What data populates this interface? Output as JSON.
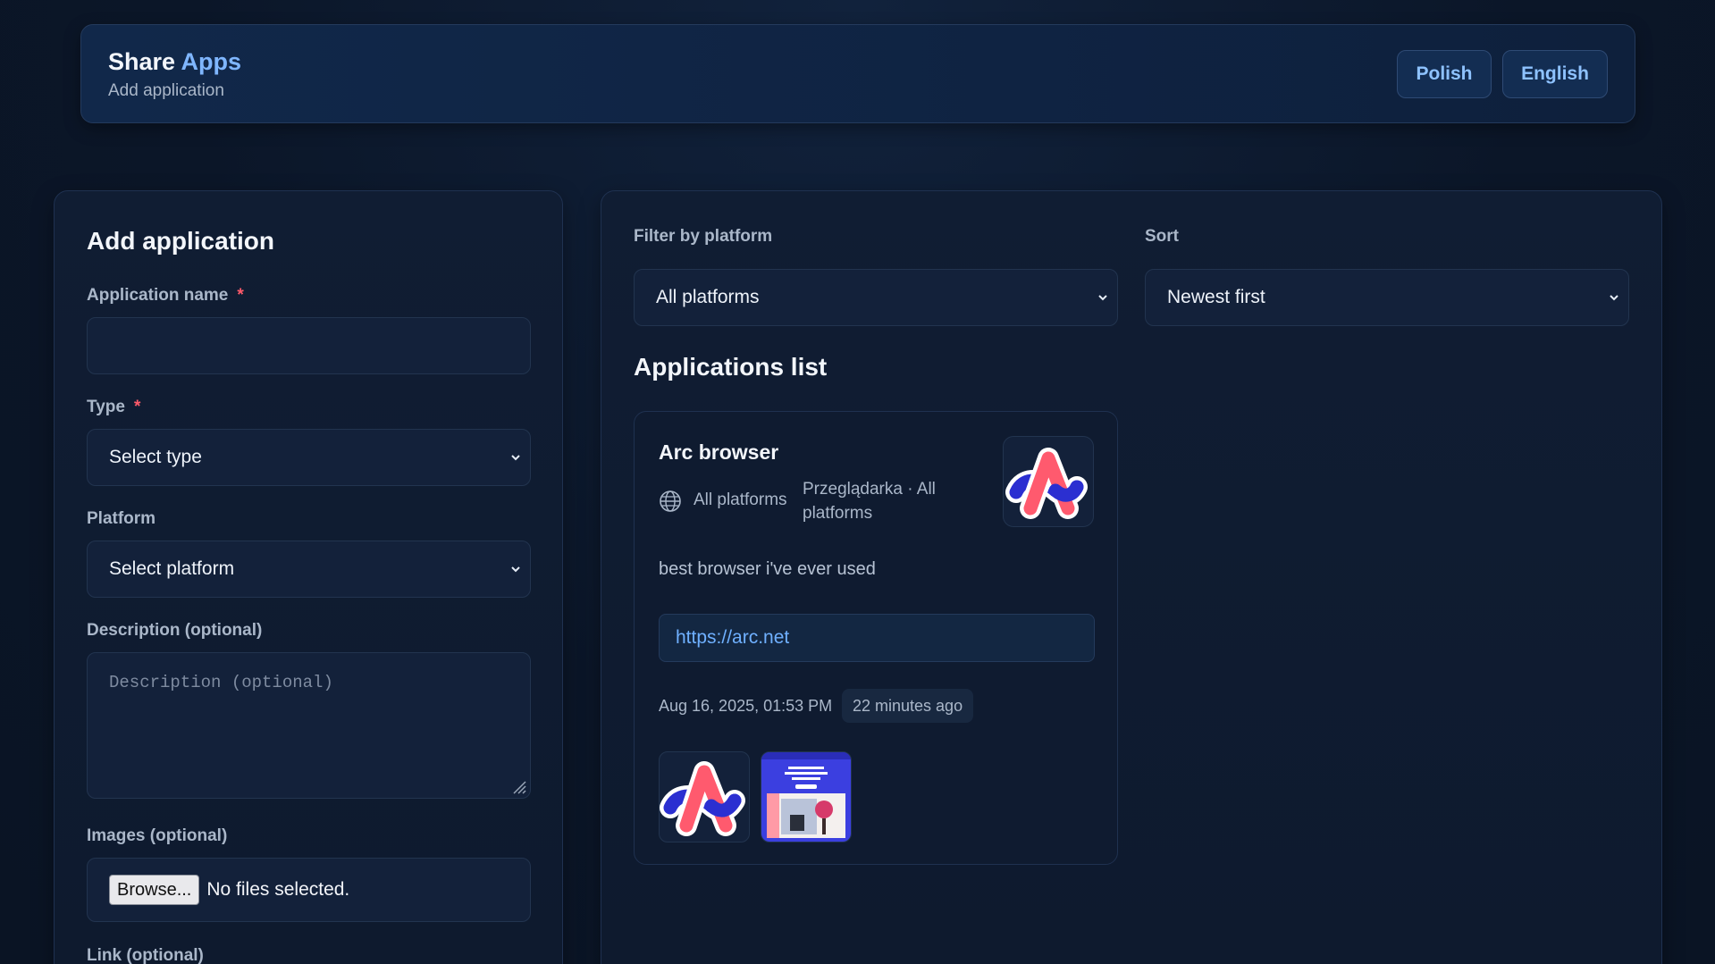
{
  "header": {
    "brand_part1": "Share",
    "brand_part2": "Apps",
    "subtitle": "Add application",
    "languages": [
      "Polish",
      "English"
    ]
  },
  "form": {
    "title": "Add application",
    "app_name_label": "Application name",
    "required_mark": "*",
    "app_name_value": "",
    "type_label": "Type",
    "type_value": "Select type",
    "platform_label": "Platform",
    "platform_value": "Select platform",
    "description_label": "Description (optional)",
    "description_placeholder": "Description (optional)",
    "images_label": "Images (optional)",
    "browse_label": "Browse...",
    "file_status": "No files selected.",
    "link_label": "Link (optional)"
  },
  "filters": {
    "platform_label": "Filter by platform",
    "platform_value": "All platforms",
    "sort_label": "Sort",
    "sort_value": "Newest first"
  },
  "list": {
    "title": "Applications list",
    "apps": [
      {
        "name": "Arc browser",
        "platform": "All platforms",
        "type_line": "Przeglądarka · All platforms",
        "description": "best browser i've ever used",
        "link": "https://arc.net",
        "date": "Aug 16, 2025, 01:53 PM",
        "relative_time": "22 minutes ago"
      }
    ]
  },
  "colors": {
    "accent": "#7fb6ff",
    "link": "#6fb0ff",
    "required": "#ff5a6a",
    "background": "#0b1628"
  },
  "icons": [
    "chevron-down-icon",
    "globe-icon",
    "arc-logo",
    "resize-grip-icon"
  ]
}
